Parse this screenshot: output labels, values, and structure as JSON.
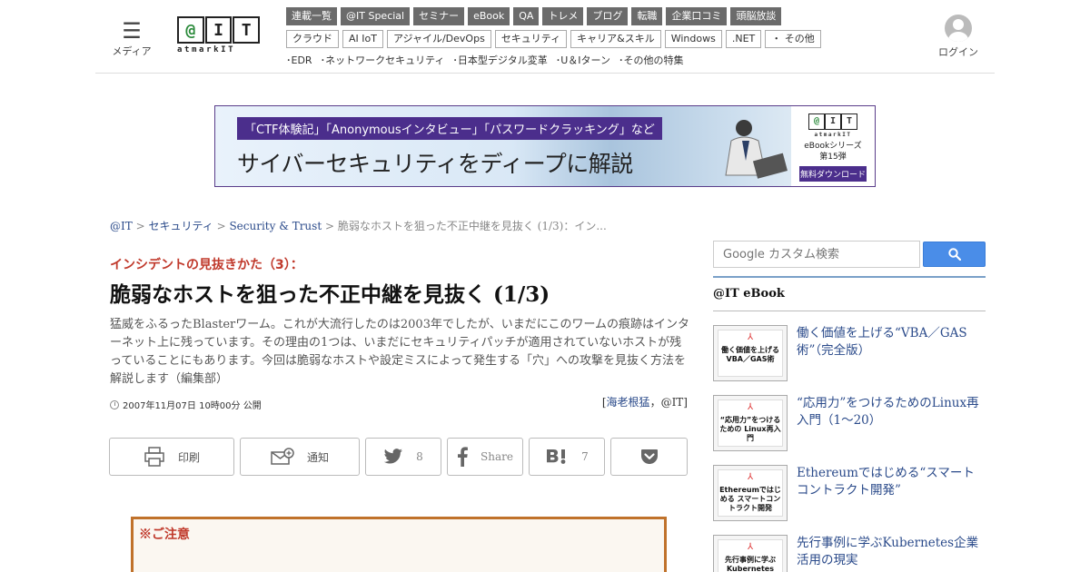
{
  "header": {
    "menu_label": "メディア",
    "logo_letters": [
      "@",
      "I",
      "T"
    ],
    "logo_sub": "atmarkIT",
    "login_label": "ログイン",
    "categories_row1": [
      "連載一覧",
      "@IT Special",
      "セミナー",
      "eBook",
      "QA",
      "トレメ",
      "ブログ",
      "転職",
      "企業口コミ",
      "頭脳放談"
    ],
    "categories_row2": [
      "クラウド",
      "AI IoT",
      "アジャイル/DevOps",
      "セキュリティ",
      "キャリア&スキル",
      "Windows",
      ".NET",
      "・ その他"
    ],
    "features": [
      "･EDR",
      "･ネットワークセキュリティ",
      "･日本型デジタル変革",
      "･U＆Iターン",
      "･その他の特集"
    ]
  },
  "banner": {
    "tag": "「CTF体験記」「Anonymousインタビュー」「パスワードクラッキング」など",
    "headline": "サイバーセキュリティをディープに解説",
    "series_line1": "eBookシリーズ",
    "series_line2": "第15弾",
    "download": "無料ダウンロード",
    "colors": {
      "accent": "#4b2e8c"
    }
  },
  "breadcrumb": {
    "items": [
      "@IT",
      "セキュリティ",
      "Security & Trust"
    ],
    "current": "脆弱なホストを狙った不正中継を見抜く (1/3)：イン..."
  },
  "article": {
    "series": "インシデントの見抜きかた（3）：",
    "title": "脆弱なホストを狙った不正中継を見抜く (1/3)",
    "lead": "猛威をふるったBlasterワーム。これが大流行したのは2003年でしたが、いまだにこのワームの痕跡はインターネット上に残っています。その理由の1つは、いまだにセキュリティパッチが適用されていないホストが残っていることにもあります。今回は脆弱なホストや設定ミスによって発生する「穴」への攻撃を見抜く方法を解説します（編集部）",
    "pubdate": "2007年11月07日 10時00分 公開",
    "author_open": "[",
    "author_name": "海老根猛",
    "author_suffix": "，@IT]"
  },
  "share": {
    "print": "印刷",
    "notify": "通知",
    "twitter_count": "8",
    "facebook": "Share",
    "hatena_count": "7"
  },
  "notice": {
    "title": "※ご注意"
  },
  "sidebar": {
    "search_placeholder": "Google カスタム検索",
    "ebook_heading": "@IT eBook",
    "ebooks": [
      {
        "title": "働く価値を上げる“VBA／GAS術”（完全版）",
        "thumb": "働く価値を上げる VBA／GAS術"
      },
      {
        "title": "“応用力”をつけるためのLinux再入門（1～20）",
        "thumb": "“応用力”をつけるための Linux再入門"
      },
      {
        "title": "Ethereumではじめる“スマートコントラクト開発”",
        "thumb": "Ethereumではじめる スマートコントラクト開発"
      },
      {
        "title": "先行事例に学ぶKubernetes企業活用の現実",
        "thumb": "先行事例に学ぶ Kubernetes"
      }
    ]
  }
}
